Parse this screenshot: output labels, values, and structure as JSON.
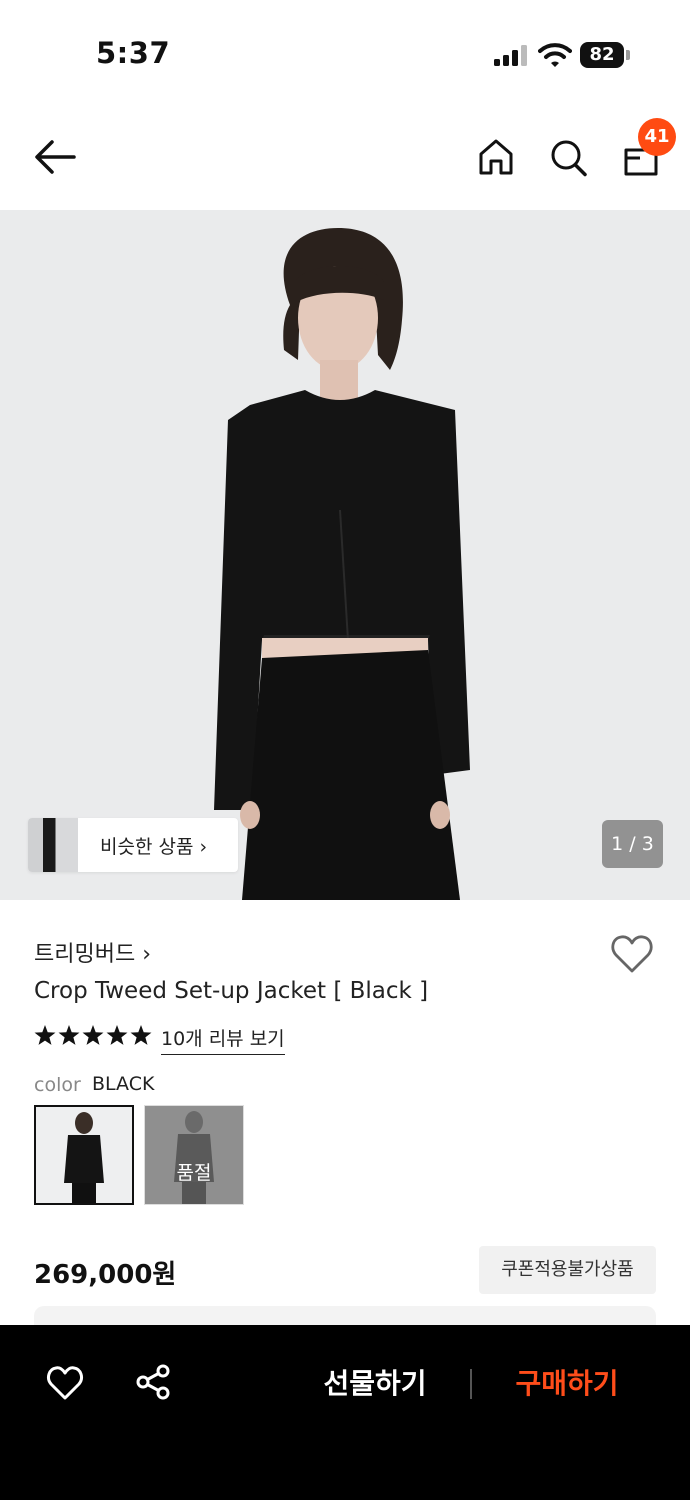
{
  "status_bar": {
    "time": "5:37",
    "battery": "82"
  },
  "header": {
    "cart_count": "41"
  },
  "gallery": {
    "similar_label": "비슷한 상품 ›",
    "pager": "1 / 3"
  },
  "product": {
    "brand": "트리밍버드 ›",
    "title": "Crop Tweed Set-up Jacket [ Black ]",
    "rating_stars": 5,
    "review_link": "10개 리뷰 보기",
    "color_label": "color",
    "color_value": "BLACK",
    "swatches": [
      {
        "state": "selected"
      },
      {
        "state": "soldout",
        "label": "품절"
      }
    ],
    "price": "269,000원",
    "coupon_note": "쿠폰적용불가상품"
  },
  "bottom_bar": {
    "gift_label": "선물하기",
    "buy_label": "구매하기"
  },
  "colors": {
    "accent": "#ff4b12",
    "buy": "#ff4d1a",
    "bar_bg": "#000000",
    "hero_bg": "#eaebec"
  },
  "icons": [
    "back-arrow-icon",
    "home-icon",
    "search-icon",
    "cart-icon",
    "heart-icon",
    "share-icon",
    "star-icon"
  ]
}
